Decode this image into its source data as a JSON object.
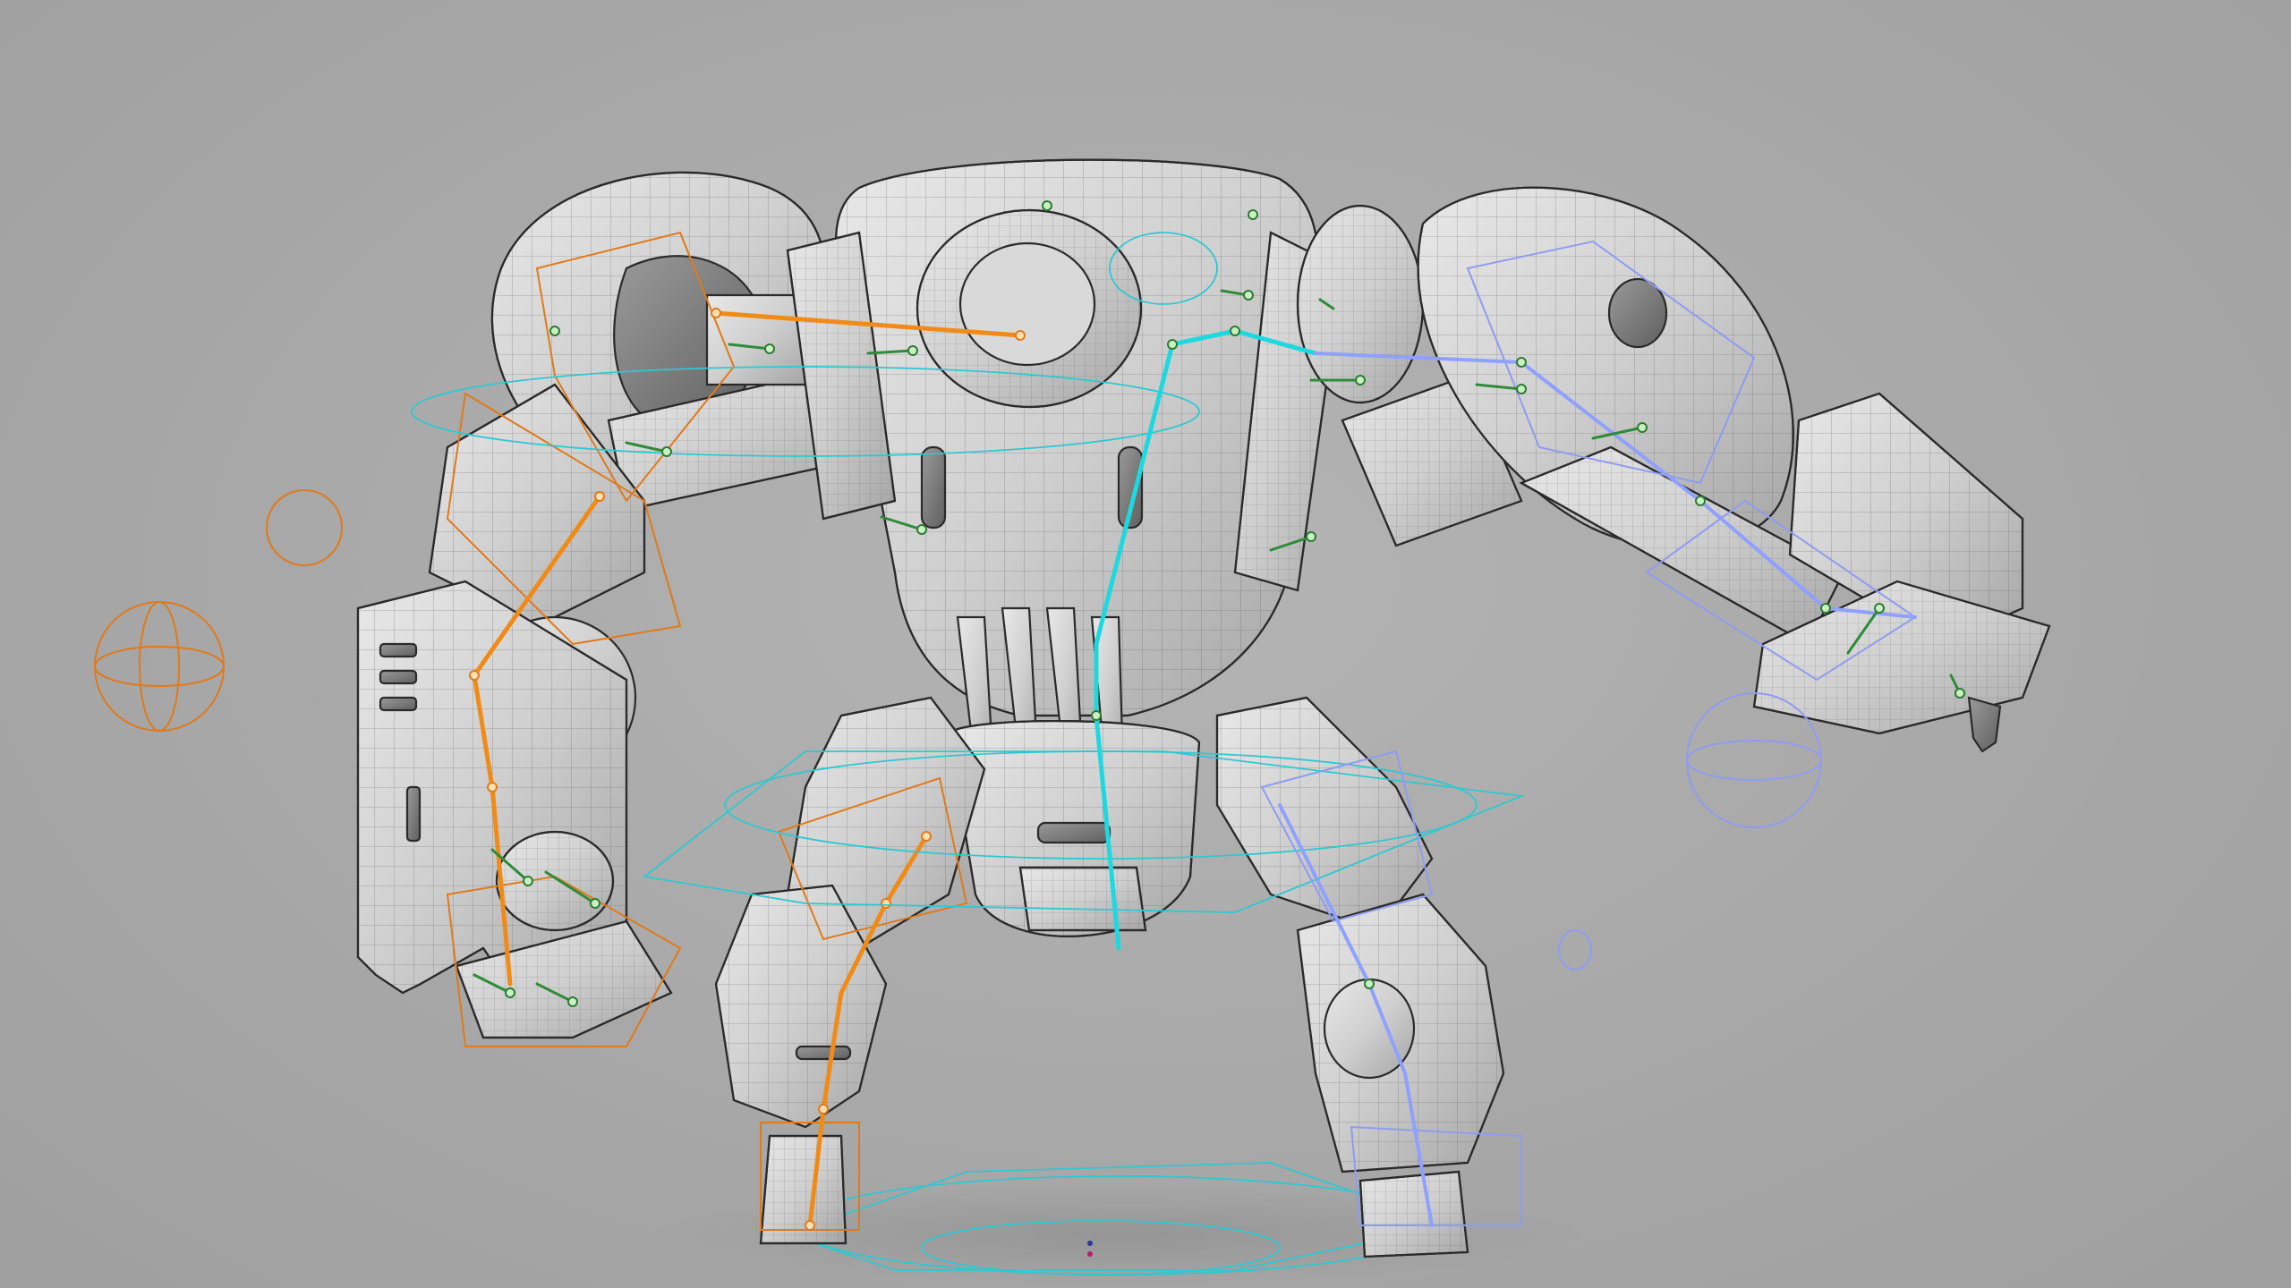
{
  "viewport": {
    "shading_mode": "wireframe-on-shaded",
    "background_color": "#a9a9a9",
    "colors": {
      "left_rig": "#f08b18",
      "spine_rig": "#1ed8e0",
      "right_rig": "#8fa0ff",
      "joints": "#2f8a3a",
      "mesh_wire": "#2a2a2a"
    }
  },
  "rig_controls": {
    "left_side": "orange",
    "center_spine": "cyan",
    "right_side": "light-blue",
    "helper_joints": "green"
  }
}
